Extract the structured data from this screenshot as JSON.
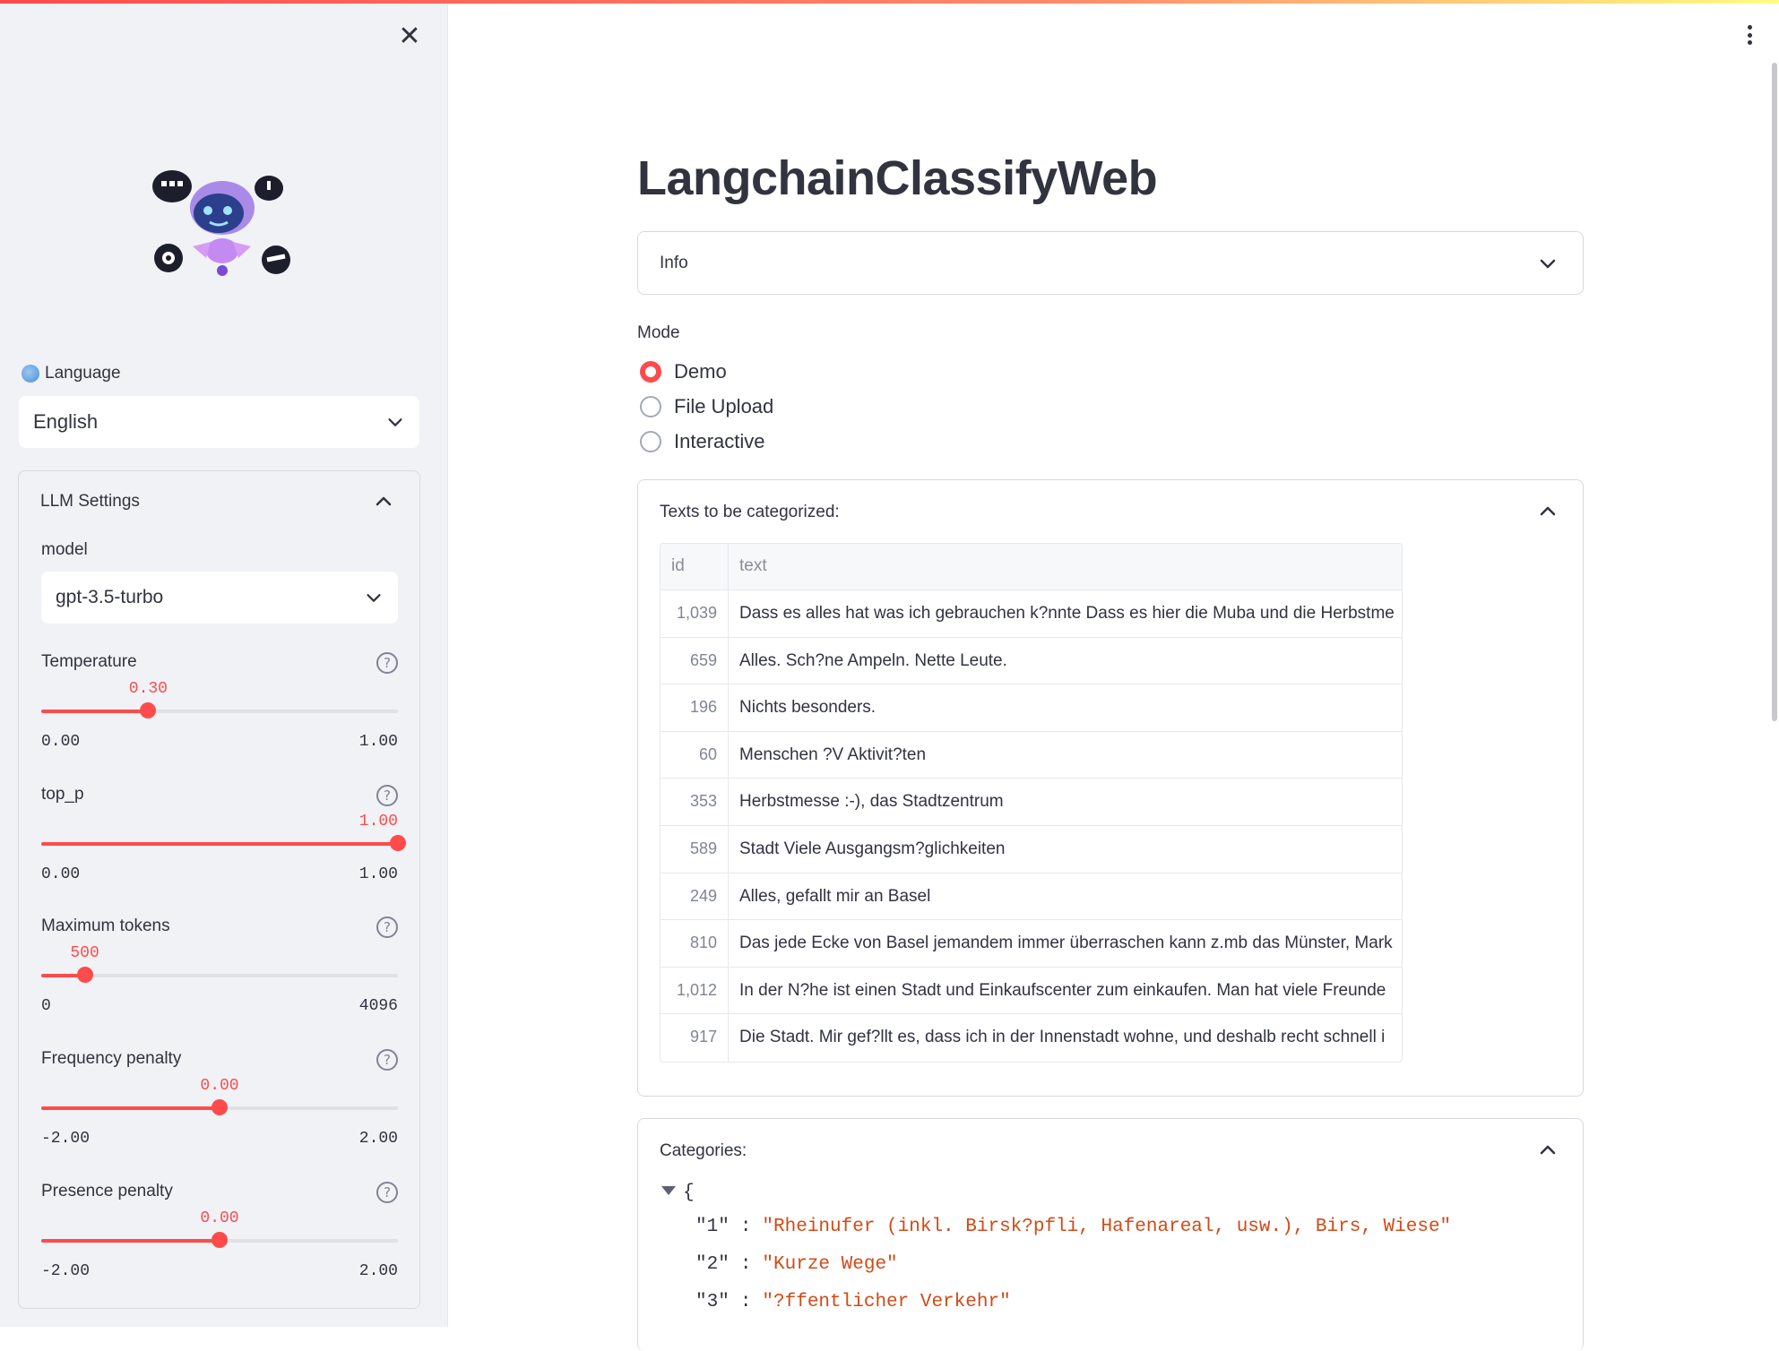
{
  "sidebar": {
    "close_icon": "close-icon",
    "language_label": "Language",
    "language_value": "English",
    "llm_settings_title": "LLM Settings",
    "model_label": "model",
    "model_value": "gpt-3.5-turbo",
    "sliders": {
      "temperature": {
        "label": "Temperature",
        "value": "0.30",
        "min": "0.00",
        "max": "1.00",
        "fraction": 0.3
      },
      "top_p": {
        "label": "top_p",
        "value": "1.00",
        "min": "0.00",
        "max": "1.00",
        "fraction": 1.0
      },
      "max_tokens": {
        "label": "Maximum tokens",
        "value": "500",
        "min": "0",
        "max": "4096",
        "fraction": 0.122
      },
      "frequency_penalty": {
        "label": "Frequency penalty",
        "value": "0.00",
        "min": "-2.00",
        "max": "2.00",
        "fraction": 0.5
      },
      "presence_penalty": {
        "label": "Presence penalty",
        "value": "0.00",
        "min": "-2.00",
        "max": "2.00",
        "fraction": 0.5
      }
    },
    "accent_color": "#ff4b4b"
  },
  "main": {
    "title": "LangchainClassifyWeb",
    "info_label": "Info",
    "mode_label": "Mode",
    "modes": [
      {
        "label": "Demo",
        "selected": true
      },
      {
        "label": "File Upload",
        "selected": false
      },
      {
        "label": "Interactive",
        "selected": false
      }
    ],
    "texts_expander_label": "Texts to be categorized:",
    "table": {
      "columns": [
        "id",
        "text"
      ],
      "rows": [
        {
          "id": "1,039",
          "text": "Dass es alles hat was ich gebrauchen k?nnte  Dass es hier die Muba und die Herbstme"
        },
        {
          "id": "659",
          "text": "Alles.  Sch?ne Ampeln.  Nette Leute."
        },
        {
          "id": "196",
          "text": "Nichts besonders."
        },
        {
          "id": "60",
          "text": "Menschen  ?V  Aktivit?ten"
        },
        {
          "id": "353",
          "text": "Herbstmesse :-), das Stadtzentrum"
        },
        {
          "id": "589",
          "text": "Stadt  Viele Ausgangsm?glichkeiten"
        },
        {
          "id": "249",
          "text": "Alles, gefallt mir an Basel"
        },
        {
          "id": "810",
          "text": "Das jede Ecke von Basel jemandem immer überraschen kann z.mb das Münster, Mark"
        },
        {
          "id": "1,012",
          "text": "In der N?he ist einen Stadt und Einkaufscenter zum einkaufen. Man hat viele Freunde"
        },
        {
          "id": "917",
          "text": "Die Stadt. Mir gef?llt es, dass ich in der Innenstadt wohne, und deshalb recht schnell i"
        }
      ]
    },
    "categories_expander_label": "Categories:",
    "categories_json": {
      "open_brace": "{",
      "entries": [
        {
          "key": "\"1\"",
          "value": "\"Rheinufer (inkl. Birsk?pfli, Hafenareal, usw.), Birs, Wiese\""
        },
        {
          "key": "\"2\"",
          "value": "\"Kurze Wege\""
        },
        {
          "key": "\"3\"",
          "value": "\"?ffentlicher Verkehr\""
        }
      ],
      "separator": ":"
    }
  }
}
